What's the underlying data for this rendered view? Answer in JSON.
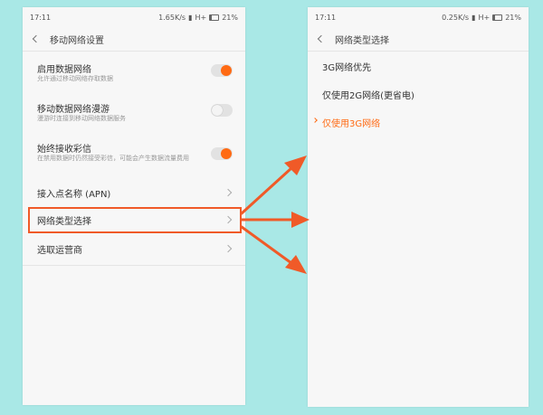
{
  "left": {
    "status": {
      "time": "17:11",
      "speed": "1.65K/s",
      "net": "H+",
      "battery": "21%"
    },
    "title": "移动网络设置",
    "items": [
      {
        "title": "启用数据网络",
        "sub": "允许通过移动网络存取数据",
        "toggle": "on"
      },
      {
        "title": "移动数据网络漫游",
        "sub": "漫游时连接到移动网络数据服务",
        "toggle": "off"
      },
      {
        "title": "始终接收彩信",
        "sub": "在禁用数据时仍然接受彩信，可能会产生数据流量费用",
        "toggle": "on"
      },
      {
        "title": "接入点名称 (APN)"
      },
      {
        "title": "网络类型选择"
      },
      {
        "title": "选取运营商"
      }
    ]
  },
  "right": {
    "status": {
      "time": "17:11",
      "speed": "0.25K/s",
      "net": "H+",
      "battery": "21%"
    },
    "title": "网络类型选择",
    "options": [
      {
        "label": "3G网络优先",
        "selected": false
      },
      {
        "label": "仅使用2G网络(更省电)",
        "selected": false
      },
      {
        "label": "仅使用3G网络",
        "selected": true
      }
    ]
  },
  "colors": {
    "accent": "#ff6a13",
    "annotation": "#f05a28",
    "background": "#a9e8e6"
  }
}
